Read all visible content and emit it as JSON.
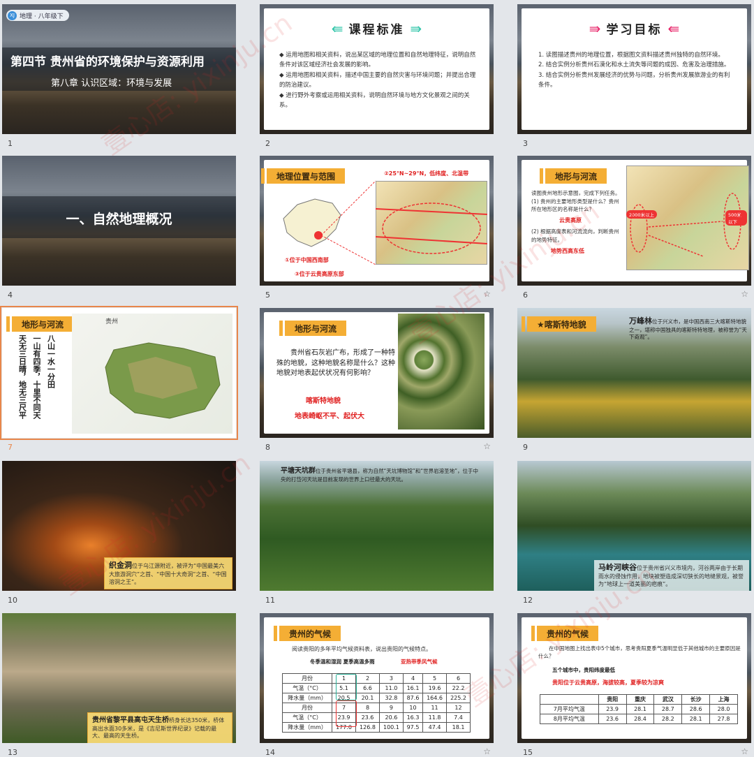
{
  "badge": {
    "avatar": "XJ",
    "text": "地理 · 八年级下"
  },
  "watermark": "壹心店: yixinju.cn",
  "slides": [
    {
      "num": "1",
      "title": "第四节 贵州省的环境保护与资源利用",
      "subtitle": "第八章 认识区域：环境与发展"
    },
    {
      "num": "2",
      "header": "课程标准",
      "bullets": [
        "运用地图和相关资料，说出某区域的地理位置和自然地理特征，说明自然条件对该区域经济社会发展的影响。",
        "运用地图和相关资料，描述中国主要的自然灾害与环境问题；并提出合理的防治建议。",
        "进行野外考察或运用相关资料，说明自然环境与地方文化景观之间的关系。"
      ]
    },
    {
      "num": "3",
      "header": "学习目标",
      "items": [
        "1. 读图描述贵州的地理位置，根据图文资料描述贵州独特的自然环境。",
        "2. 结合实例分析贵州石漠化和水土流失等问题的成因、危害及治理措施。",
        "3. 结合实例分析贵州发展经济的优势与问题，分析贵州发展旅游业的有利条件。"
      ]
    },
    {
      "num": "4",
      "title": "一、自然地理概况"
    },
    {
      "num": "5",
      "tab": "地理位置与范围",
      "note_top": "②25°N~29°N，低纬度、北温带",
      "note_a": "①位于中国西南部",
      "note_b": "③位于云贵高原东部"
    },
    {
      "num": "6",
      "tab": "地形与河流",
      "intro": "读图贵州地形示意图，完成下列任务。",
      "q1": "(1) 贵州的主要地形类型是什么？贵州所在地形区的名称是什么？",
      "a1": "云贵高原",
      "q2": "(2) 根据高度表和河流流向，判断贵州的地势特征。",
      "a2": "地势西高东低",
      "mark_w": "2000米以上",
      "mark_e": "500米以下"
    },
    {
      "num": "7",
      "tab": "地形与河流",
      "map_label": "贵州",
      "verse_a": "八山一水一分田",
      "verse_b": "一山有四季，十里不同天",
      "verse_c": "天无三日晴，地无三尺平"
    },
    {
      "num": "8",
      "tab": "地形与河流",
      "text": "贵州省石灰岩广布，形成了一种特殊的地貌，这种地貌名称是什么？这种地貌对地表起伏状况有何影响？",
      "a1": "喀斯特地貌",
      "a2": "地表崎岖不平、起伏大"
    },
    {
      "num": "9",
      "tag": "★喀斯特地貌",
      "cap_title": "万峰林",
      "cap": "位于兴义市，是中国西南三大喀斯特地貌之一，堪称中国独具的喀斯特特地理，被称誉为“天下奇观”。"
    },
    {
      "num": "10",
      "cap_title": "织金洞",
      "cap": "位于乌江源附近，被评为“中国最美六大旅游洞穴”之首、“中国十大奇洞”之首、“中国溶洞之王”。"
    },
    {
      "num": "11",
      "cap_title": "平塘天坑群",
      "cap": "位于贵州省平塘县，称为自然“天坑博物馆”和“世界岩溶圣地”，位于中央的打岱河天坑是目前发现的世界上口径最大的天坑。"
    },
    {
      "num": "12",
      "cap_title": "马岭河峡谷",
      "cap": "位于贵州省兴义市境内，河谷两岸由于长期雨水的侵蚀作用，地块被塑造成深切狭长的地缝景观，被誉为“地球上一道美丽的疤痕”。"
    },
    {
      "num": "13",
      "cap_title": "贵州省黎平县高屯天生桥",
      "cap": "桥身长达350米，桥体高出水面30多米，是《吉尼斯世界纪录》记载的最大、最高的天生桥。"
    },
    {
      "num": "14",
      "tab": "贵州的气候",
      "prompt": "阅读贵阳的多年平均气候资料表，说出贵阳的气候特点。",
      "hint_a": "冬季温和湿润 夏季高温多雨",
      "hint_b": "亚热带季风气候",
      "table": {
        "r1": [
          "月份",
          "1",
          "2",
          "3",
          "4",
          "5",
          "6"
        ],
        "r2": [
          "气温（°C）",
          "5.1",
          "6.6",
          "11.0",
          "16.1",
          "19.6",
          "22.2"
        ],
        "r3": [
          "降水量（mm）",
          "20.5",
          "20.1",
          "32.8",
          "87.6",
          "164.6",
          "225.2"
        ],
        "r4": [
          "月份",
          "7",
          "8",
          "9",
          "10",
          "11",
          "12"
        ],
        "r5": [
          "气温（°C）",
          "23.9",
          "23.6",
          "20.6",
          "16.3",
          "11.8",
          "7.4"
        ],
        "r6": [
          "降水量（mm）",
          "177.0",
          "126.8",
          "100.1",
          "97.5",
          "47.4",
          "18.1"
        ]
      }
    },
    {
      "num": "15",
      "tab": "贵州的气候",
      "prompt": "在中国地图上找出表中5个城市，思考贵阳夏季气温明显低于其他城市的主要原因是什么？",
      "hint_a": "五个城市中，贵阳纬度最低",
      "hint_b": "贵阳位于云贵高原，海拔较高，夏季较为凉爽",
      "table": {
        "head": [
          "",
          "贵阳",
          "重庆",
          "武汉",
          "长沙",
          "上海"
        ],
        "r1": [
          "7月平均气温",
          "23.9",
          "28.1",
          "28.7",
          "28.6",
          "28.0"
        ],
        "r2": [
          "8月平均气温",
          "23.6",
          "28.4",
          "28.2",
          "28.1",
          "27.8"
        ]
      }
    }
  ]
}
